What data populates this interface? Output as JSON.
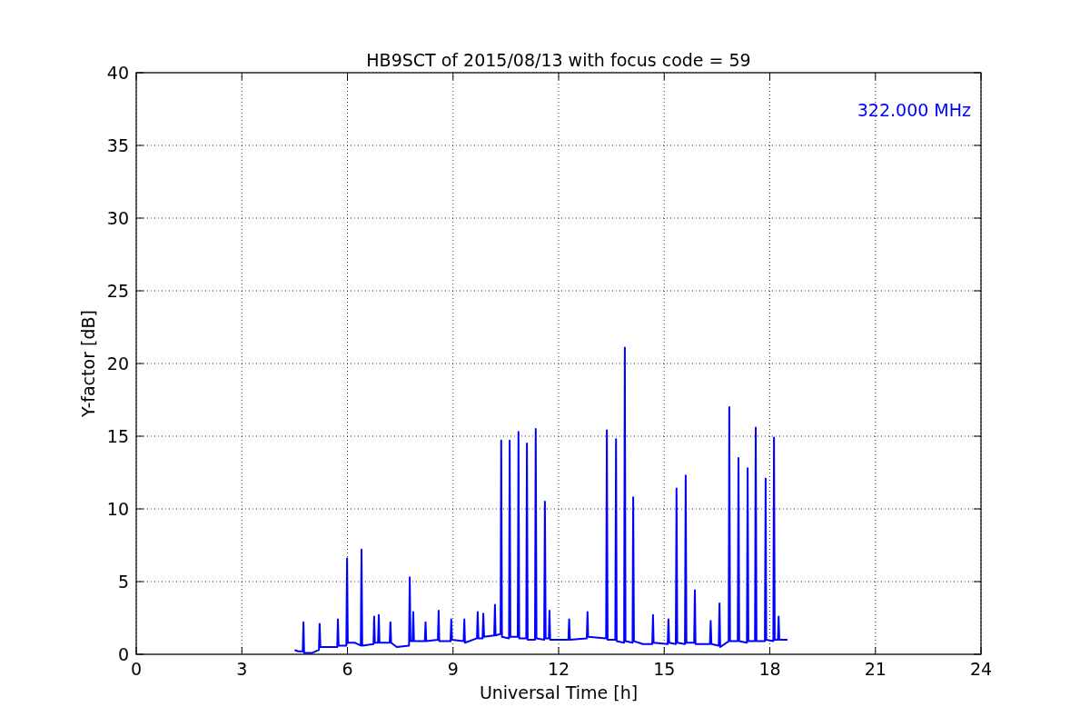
{
  "chart_data": {
    "type": "line",
    "title": "HB9SCT of 2015/08/13 with focus code = 59",
    "xlabel": "Universal Time [h]",
    "ylabel": "Y-factor [dB]",
    "xlim": [
      0,
      24
    ],
    "ylim": [
      0,
      40
    ],
    "xticks": [
      0,
      3,
      6,
      9,
      12,
      15,
      18,
      21,
      24
    ],
    "yticks": [
      0,
      5,
      10,
      15,
      20,
      25,
      30,
      35,
      40
    ],
    "grid": true,
    "x": [
      4.5,
      4.6,
      4.73,
      4.75,
      4.77,
      5.0,
      5.19,
      5.21,
      5.23,
      5.5,
      5.71,
      5.73,
      5.75,
      5.97,
      5.99,
      6.01,
      6.2,
      6.38,
      6.4,
      6.42,
      6.74,
      6.76,
      6.78,
      6.87,
      6.89,
      6.91,
      7.2,
      7.22,
      7.24,
      7.4,
      7.75,
      7.77,
      7.79,
      7.85,
      7.87,
      7.89,
      8.2,
      8.22,
      8.24,
      8.57,
      8.59,
      8.61,
      8.93,
      8.95,
      8.97,
      9.3,
      9.32,
      9.34,
      9.68,
      9.7,
      9.72,
      9.84,
      9.86,
      9.88,
      10.17,
      10.19,
      10.21,
      10.35,
      10.37,
      10.39,
      10.59,
      10.61,
      10.63,
      10.84,
      10.86,
      10.88,
      11.08,
      11.1,
      11.12,
      11.33,
      11.35,
      11.37,
      11.59,
      11.61,
      11.63,
      11.72,
      11.74,
      11.76,
      12.0,
      12.28,
      12.3,
      12.32,
      12.8,
      12.82,
      12.84,
      13.35,
      13.37,
      13.39,
      13.61,
      13.63,
      13.65,
      13.86,
      13.88,
      13.9,
      14.1,
      14.12,
      14.14,
      14.4,
      14.66,
      14.68,
      14.7,
      15.1,
      15.12,
      15.14,
      15.33,
      15.35,
      15.37,
      15.59,
      15.61,
      15.63,
      15.85,
      15.87,
      15.89,
      16.3,
      16.32,
      16.34,
      16.55,
      16.57,
      16.59,
      16.83,
      16.85,
      16.87,
      17.09,
      17.11,
      17.13,
      17.35,
      17.37,
      17.39,
      17.58,
      17.6,
      17.62,
      17.86,
      17.88,
      17.9,
      18.1,
      18.12,
      18.14,
      18.23,
      18.25,
      18.27,
      18.5
    ],
    "series": [
      {
        "name": "322.000 MHz",
        "color": "#0000ff",
        "values": [
          0.3,
          0.2,
          0.2,
          2.2,
          0.1,
          0.1,
          0.3,
          2.1,
          0.5,
          0.5,
          0.5,
          2.4,
          0.6,
          0.6,
          6.6,
          0.8,
          0.8,
          0.6,
          7.2,
          0.6,
          0.7,
          2.6,
          0.8,
          0.8,
          2.7,
          0.8,
          0.8,
          2.2,
          0.8,
          0.5,
          0.6,
          5.3,
          0.9,
          0.9,
          2.9,
          0.9,
          0.9,
          2.2,
          0.9,
          1.0,
          3.0,
          0.9,
          0.9,
          2.4,
          1.0,
          0.9,
          2.4,
          0.8,
          1.1,
          2.9,
          1.1,
          1.1,
          2.8,
          1.2,
          1.3,
          3.4,
          1.3,
          1.4,
          14.7,
          1.2,
          1.1,
          14.7,
          1.2,
          1.2,
          15.3,
          1.1,
          1.1,
          14.5,
          1.0,
          1.0,
          15.5,
          1.1,
          1.0,
          10.5,
          1.1,
          1.1,
          3.0,
          1.0,
          1.0,
          1.0,
          2.4,
          1.0,
          1.1,
          2.9,
          1.2,
          1.1,
          15.4,
          1.0,
          1.0,
          14.8,
          0.9,
          0.8,
          21.1,
          0.9,
          0.8,
          10.8,
          0.9,
          0.7,
          0.7,
          2.7,
          0.8,
          0.7,
          2.4,
          0.8,
          0.7,
          11.4,
          0.8,
          0.7,
          12.3,
          0.8,
          0.8,
          4.4,
          0.7,
          0.7,
          2.3,
          0.7,
          0.6,
          3.5,
          0.5,
          0.9,
          17.0,
          0.9,
          0.9,
          13.5,
          0.9,
          0.8,
          12.8,
          0.9,
          0.9,
          15.6,
          0.9,
          0.9,
          12.1,
          1.0,
          0.9,
          14.9,
          1.0,
          1.0,
          2.6,
          1.0,
          1.0
        ]
      }
    ]
  }
}
